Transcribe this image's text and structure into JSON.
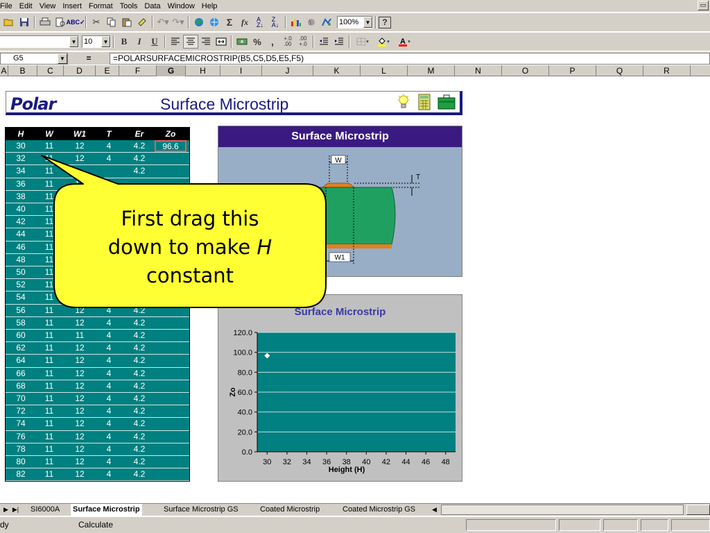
{
  "menu": [
    "File",
    "Edit",
    "View",
    "Insert",
    "Format",
    "Tools",
    "Data",
    "Window",
    "Help"
  ],
  "toolbar": {
    "zoom": "100%",
    "font_name": "",
    "font_size": "10",
    "bold": "B",
    "italic": "I",
    "underline": "U",
    "sigma": "Σ",
    "fx": "fx",
    "percent": "%",
    "comma": ",",
    "help": "?"
  },
  "formula_bar": {
    "name_box": "G5",
    "equals": "=",
    "formula": "=POLARSURFACEMICROSTRIP(B5,C5,D5,E5,F5)"
  },
  "columns": [
    "A",
    "B",
    "C",
    "D",
    "E",
    "F",
    "G",
    "H",
    "I",
    "J",
    "K",
    "L",
    "M",
    "N",
    "O",
    "P",
    "Q",
    "R"
  ],
  "selected_column": "G",
  "banner": {
    "logo": "Polar",
    "title": "Surface Microstrip"
  },
  "table": {
    "headers": [
      "H",
      "W",
      "W1",
      "T",
      "Er",
      "Zo"
    ],
    "rows": [
      [
        "30",
        "11",
        "12",
        "4",
        "4.2",
        "96.6"
      ],
      [
        "32",
        "11",
        "12",
        "4",
        "4.2",
        ""
      ],
      [
        "34",
        "11",
        "",
        "",
        "4.2",
        ""
      ],
      [
        "36",
        "11",
        "12",
        "",
        "",
        ""
      ],
      [
        "38",
        "11",
        "",
        "",
        "",
        ""
      ],
      [
        "40",
        "11",
        "",
        "",
        "",
        ""
      ],
      [
        "42",
        "11",
        "",
        "",
        "",
        ""
      ],
      [
        "44",
        "11",
        "",
        "",
        "",
        ""
      ],
      [
        "46",
        "11",
        "",
        "",
        "",
        ""
      ],
      [
        "48",
        "11",
        "",
        "",
        "",
        ""
      ],
      [
        "50",
        "11",
        "",
        "",
        "",
        ""
      ],
      [
        "52",
        "11",
        "",
        "",
        "",
        ""
      ],
      [
        "54",
        "11",
        "",
        "",
        "",
        ""
      ],
      [
        "56",
        "11",
        "12",
        "4",
        "4.2",
        ""
      ],
      [
        "58",
        "11",
        "12",
        "4",
        "4.2",
        ""
      ],
      [
        "60",
        "11",
        "11",
        "4",
        "4.2",
        ""
      ],
      [
        "62",
        "11",
        "12",
        "4",
        "4.2",
        ""
      ],
      [
        "64",
        "11",
        "12",
        "4",
        "4.2",
        ""
      ],
      [
        "66",
        "11",
        "12",
        "4",
        "4.2",
        ""
      ],
      [
        "68",
        "11",
        "12",
        "4",
        "4.2",
        ""
      ],
      [
        "70",
        "11",
        "12",
        "4",
        "4.2",
        ""
      ],
      [
        "72",
        "11",
        "12",
        "4",
        "4.2",
        ""
      ],
      [
        "74",
        "11",
        "12",
        "4",
        "4.2",
        ""
      ],
      [
        "76",
        "11",
        "12",
        "4",
        "4.2",
        ""
      ],
      [
        "78",
        "11",
        "12",
        "4",
        "4.2",
        ""
      ],
      [
        "80",
        "11",
        "12",
        "4",
        "4.2",
        ""
      ],
      [
        "82",
        "11",
        "12",
        "4",
        "4.2",
        ""
      ]
    ]
  },
  "diagram": {
    "title": "Surface Microstrip",
    "label_w": "W",
    "label_w1": "W1",
    "label_t": "T"
  },
  "callout": {
    "line1": "First drag this",
    "line2": "down to make",
    "line2_italic": "H",
    "line3": "constant"
  },
  "chart_data": {
    "type": "scatter",
    "title": "Surface Microstrip",
    "xlabel": "Height (H)",
    "ylabel": "Zo",
    "x_ticks": [
      "30",
      "32",
      "34",
      "36",
      "38",
      "40",
      "42",
      "44",
      "46",
      "48"
    ],
    "y_ticks": [
      "0.0",
      "20.0",
      "40.0",
      "60.0",
      "80.0",
      "100.0",
      "120.0"
    ],
    "xlim": [
      29,
      49
    ],
    "ylim": [
      0,
      120
    ],
    "grid": true,
    "series": [
      {
        "x": [
          30
        ],
        "y": [
          96.6
        ]
      }
    ]
  },
  "sheet_tabs": {
    "tabs": [
      "SI6000A",
      "Surface Microstrip",
      "Surface Microstrip GS",
      "Coated Microstrip",
      "Coated Microstrip GS"
    ],
    "active": "Surface Microstrip"
  },
  "status": {
    "ready": "dy",
    "calculate": "Calculate"
  },
  "colors": {
    "teal": "#008080",
    "navy": "#1a1a80",
    "purple_header": "#3a1a80",
    "callout_yellow": "#ffff33",
    "copper": "#e08020",
    "board_green": "#20a060"
  }
}
